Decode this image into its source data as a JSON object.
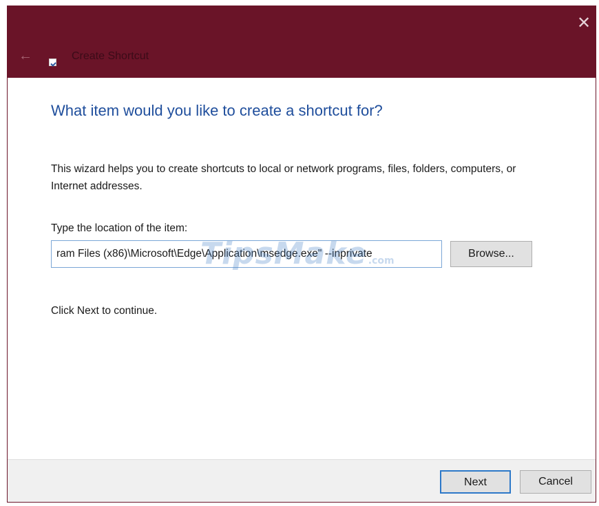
{
  "window": {
    "title": "Create Shortcut",
    "close_glyph": "✕",
    "back_glyph": "←",
    "icons": {
      "app": "shortcut-icon",
      "back": "back-arrow-icon",
      "close": "close-icon"
    },
    "colors": {
      "titlebar": "#6a1428",
      "heading": "#1f4e9c"
    }
  },
  "main": {
    "heading": "What item would you like to create a shortcut for?",
    "description": "This wizard helps you to create shortcuts to local or network programs, files, folders, computers, or Internet addresses.",
    "location_label": "Type the location of the item:",
    "location_value": "ram Files (x86)\\Microsoft\\Edge\\Application\\msedge.exe\" --inprivate",
    "browse_label": "Browse...",
    "hint": "Click Next to continue."
  },
  "watermark": {
    "text": "TipsMake",
    "suffix": ".com"
  },
  "footer": {
    "next_label": "Next",
    "cancel_label": "Cancel"
  }
}
